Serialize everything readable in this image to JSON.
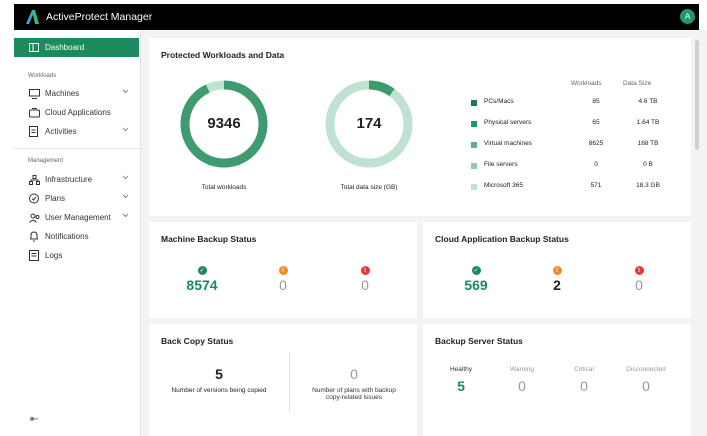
{
  "app": {
    "title": "ActiveProtect Manager",
    "avatar": "A"
  },
  "sidebar": {
    "dashboard": "Dashboard",
    "sections": {
      "workloads": "Workloads",
      "management": "Management"
    },
    "items": [
      {
        "label": "Machines"
      },
      {
        "label": "Cloud Applications"
      },
      {
        "label": "Activities"
      },
      {
        "label": "Infrastructure"
      },
      {
        "label": "Plans"
      },
      {
        "label": "User Management"
      },
      {
        "label": "Notifications"
      },
      {
        "label": "Logs"
      }
    ],
    "collapse_icon": "collapse-left-icon"
  },
  "protected": {
    "title": "Protected Workloads and Data",
    "total_workloads": {
      "value": "9346",
      "caption": "Total workloads"
    },
    "total_data": {
      "value": "174",
      "caption": "Total data size (GB)"
    },
    "columns": {
      "workloads": "Workloads",
      "size": "Data Size"
    },
    "rows": [
      {
        "name": "PCs/Macs",
        "workloads": "85",
        "size": "4.6 TB",
        "color": "#1a7a4e"
      },
      {
        "name": "Physical servers",
        "workloads": "65",
        "size": "1.64 TB",
        "color": "#1f9a60"
      },
      {
        "name": "Virtual machines",
        "workloads": "8625",
        "size": "168 TB",
        "color": "#5fb08d"
      },
      {
        "name": "File servers",
        "workloads": "0",
        "size": "0 B",
        "color": "#8fcab0"
      },
      {
        "name": "Microsoft 365",
        "workloads": "571",
        "size": "18.3 GB",
        "color": "#bfe2d2"
      }
    ],
    "donut_workloads_fraction": 0.93,
    "donut_data_fraction": 0.1
  },
  "machine_backup": {
    "title": "Machine Backup Status",
    "success": "8574",
    "warning": "0",
    "error": "0"
  },
  "cloud_backup": {
    "title": "Cloud Application Backup Status",
    "success": "569",
    "warning": "2",
    "error": "0"
  },
  "back_copy": {
    "title": "Back Copy Status",
    "versions": {
      "value": "5",
      "label": "Number of versions being copied"
    },
    "issues": {
      "value": "0",
      "label1": "Number of plans with backup",
      "label2": "copy-related issues"
    }
  },
  "backup_server": {
    "title": "Backup Server Status",
    "healthy": {
      "label": "Healthy",
      "value": "5"
    },
    "warning": {
      "label": "Warning",
      "value": "0"
    },
    "critical": {
      "label": "Critical",
      "value": "0"
    },
    "disconnected": {
      "label": "Disconnected",
      "value": "0"
    }
  },
  "colors": {
    "accent": "#1c8a5e",
    "warning": "#f08a24",
    "error": "#e03a3a"
  }
}
